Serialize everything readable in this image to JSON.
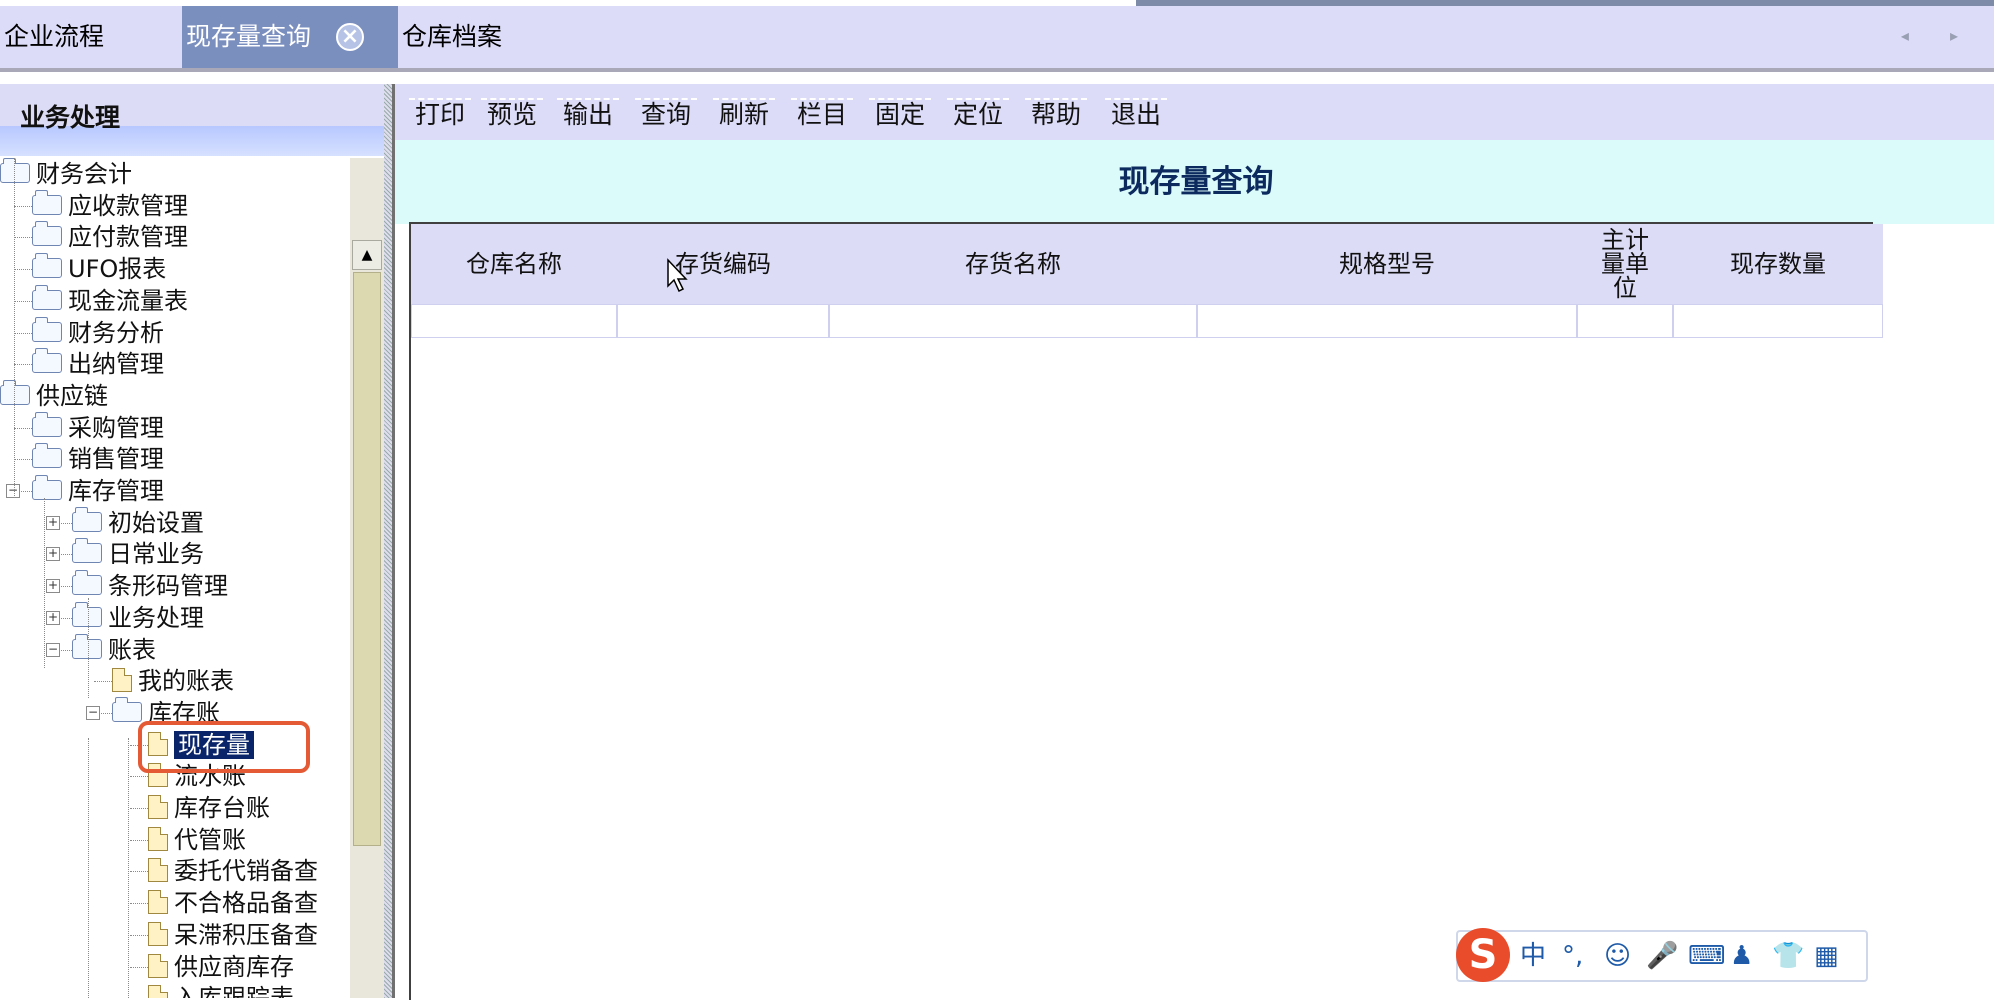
{
  "tabs": [
    {
      "label": "企业流程"
    },
    {
      "label": "现存量查询",
      "close": "×"
    },
    {
      "label": "仓库档案"
    }
  ],
  "tab_arrows": "◂ ▸",
  "left_panel": {
    "title": "业务处理",
    "tree": [
      {
        "label": "财务会计",
        "icon": "folder-open-icon"
      },
      {
        "label": "应收款管理",
        "icon": "folder-icon"
      },
      {
        "label": "应付款管理",
        "icon": "folder-icon"
      },
      {
        "label": "UFO报表",
        "icon": "folder-icon"
      },
      {
        "label": "现金流量表",
        "icon": "folder-icon"
      },
      {
        "label": "财务分析",
        "icon": "folder-icon"
      },
      {
        "label": "出纳管理",
        "icon": "folder-icon"
      },
      {
        "label": "供应链",
        "icon": "folder-open-icon"
      },
      {
        "label": "采购管理",
        "icon": "folder-icon"
      },
      {
        "label": "销售管理",
        "icon": "folder-icon"
      },
      {
        "label": "库存管理",
        "icon": "folder-icon",
        "expander": "−"
      },
      {
        "label": "初始设置",
        "icon": "folder-icon",
        "expander": "+"
      },
      {
        "label": "日常业务",
        "icon": "folder-icon",
        "expander": "+"
      },
      {
        "label": "条形码管理",
        "icon": "folder-icon",
        "expander": "+"
      },
      {
        "label": "业务处理",
        "icon": "folder-icon",
        "expander": "+"
      },
      {
        "label": "账表",
        "icon": "folder-icon",
        "expander": "−"
      },
      {
        "label": "我的账表",
        "icon": "document-icon"
      },
      {
        "label": "库存账",
        "icon": "folder-icon",
        "expander": "−"
      },
      {
        "label": "现存量",
        "icon": "document-icon",
        "selected": true
      },
      {
        "label": "流水账",
        "icon": "document-icon"
      },
      {
        "label": "库存台账",
        "icon": "document-icon"
      },
      {
        "label": "代管账",
        "icon": "document-icon"
      },
      {
        "label": "委托代销备查",
        "icon": "document-icon"
      },
      {
        "label": "不合格品备查",
        "icon": "document-icon"
      },
      {
        "label": "呆滞积压备查",
        "icon": "document-icon"
      },
      {
        "label": "供应商库存",
        "icon": "document-icon"
      },
      {
        "label": "入库跟踪表",
        "icon": "document-icon"
      }
    ],
    "scroll_up": "▲"
  },
  "toolbar": {
    "buttons": [
      "打印",
      "预览",
      "输出",
      "查询",
      "刷新",
      "栏目",
      "固定",
      "定位",
      "帮助",
      "退出"
    ]
  },
  "main": {
    "title": "现存量查询",
    "columns": [
      "仓库名称",
      "存货编码",
      "存货名称",
      "规格型号",
      "主计量单位",
      "现存数量"
    ]
  },
  "ime": {
    "logo": "S",
    "items": [
      "中",
      "°,",
      "☺",
      "🎤",
      "⌨",
      "♟",
      "👕",
      "▦"
    ]
  },
  "colors": {
    "active_tab": "#7b8fbf",
    "tab_bar": "#dcdcf8",
    "title_band": "#dbfafa",
    "selection": "#0a246a",
    "highlight": "#e45a35"
  }
}
